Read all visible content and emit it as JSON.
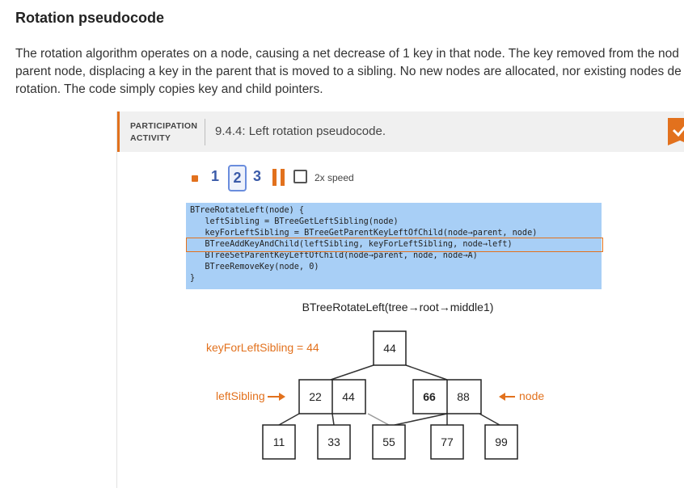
{
  "section": {
    "heading": "Rotation pseudocode",
    "intro_lines": [
      "The rotation algorithm operates on a node, causing a net decrease of 1 key in that node. The key removed from the nod",
      "parent node, displacing a key in the parent that is moved to a sibling. No new nodes are allocated, nor existing nodes de",
      "rotation. The code simply copies key and child pointers."
    ]
  },
  "activity": {
    "tag_line1": "PARTICIPATION",
    "tag_line2": "ACTIVITY",
    "title": "9.4.4: Left rotation pseudocode.",
    "badge_icon": "checkmark-icon",
    "accent_color": "#e2711d",
    "controls": {
      "stop_icon": "stop-icon",
      "steps": [
        "1",
        "2",
        "3"
      ],
      "current_step": "2",
      "pause_icon": "pause-icon",
      "speed_label": "2x speed",
      "speed_checked": false
    },
    "code_lines": [
      "BTreeRotateLeft(node) {",
      "   leftSibling = BTreeGetLeftSibling(node)",
      "   keyForLeftSibling = BTreeGetParentKeyLeftOfChild(node→parent, node)",
      "   BTreeAddKeyAndChild(leftSibling, keyForLeftSibling, node→left)",
      "   BTreeSetParentKeyLeftOfChild(node→parent, node, node→A)",
      "   BTreeRemoveKey(node, 0)",
      "}"
    ],
    "highlighted_line": 3,
    "code_bg_color": "#a8cff6",
    "diagram": {
      "call_label": "BTreeRotateLeft(tree→root→middle1)",
      "var_label": "keyForLeftSibling = 44",
      "left_sibling_label": "leftSibling",
      "node_label": "node",
      "root_keys": [
        "44"
      ],
      "left_sibling_keys": [
        "22",
        "44"
      ],
      "node_keys": [
        "66",
        "88"
      ],
      "leaf_keys": [
        "11",
        "33",
        "55",
        "77",
        "99"
      ]
    }
  }
}
